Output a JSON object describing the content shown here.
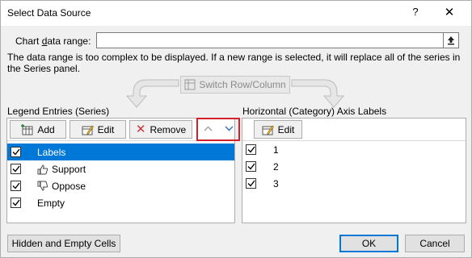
{
  "window": {
    "title": "Select Data Source",
    "help": "?",
    "close": "✕"
  },
  "range": {
    "label": "Chart data range:",
    "value": "",
    "note": "The data range is too complex to be displayed. If a new range is selected, it will replace all of the series in the Series panel."
  },
  "switch_label": "Switch Row/Column",
  "legend": {
    "title": "Legend Entries (Series)",
    "add": "Add",
    "edit": "Edit",
    "remove": "Remove",
    "items": [
      {
        "label": "Labels",
        "checked": true,
        "selected": true,
        "icon": ""
      },
      {
        "label": "Support",
        "checked": true,
        "selected": false,
        "icon": "thumbs-up-icon"
      },
      {
        "label": "Oppose",
        "checked": true,
        "selected": false,
        "icon": "thumbs-down-icon"
      },
      {
        "label": "Empty",
        "checked": true,
        "selected": false,
        "icon": ""
      }
    ]
  },
  "axis": {
    "title": "Horizontal (Category) Axis Labels",
    "edit": "Edit",
    "items": [
      {
        "label": "1",
        "checked": true
      },
      {
        "label": "2",
        "checked": true
      },
      {
        "label": "3",
        "checked": true
      }
    ]
  },
  "footer": {
    "hidden_empty": "Hidden and Empty Cells",
    "ok": "OK",
    "cancel": "Cancel"
  },
  "colors": {
    "selection": "#0078d7",
    "highlight": "#d4202a",
    "remove_icon": "#d13438"
  }
}
